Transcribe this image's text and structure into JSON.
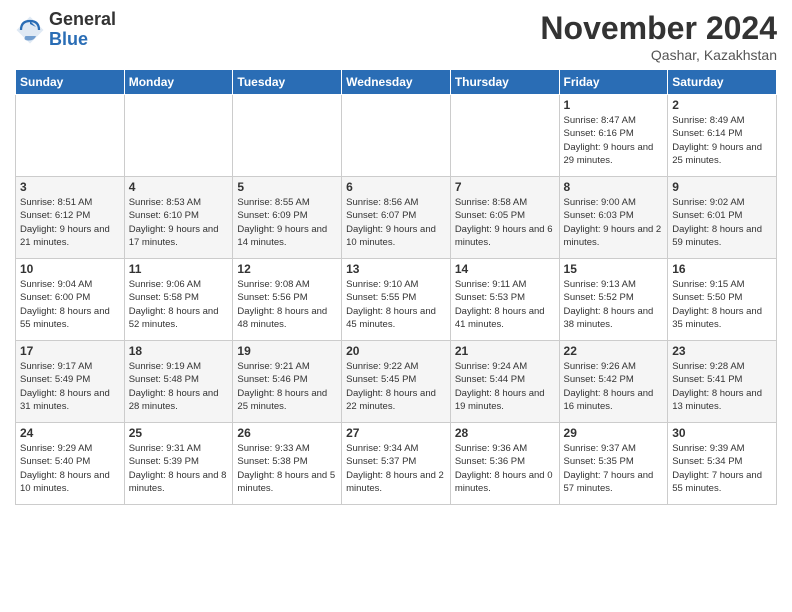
{
  "header": {
    "logo_general": "General",
    "logo_blue": "Blue",
    "month_title": "November 2024",
    "location": "Qashar, Kazakhstan"
  },
  "weekdays": [
    "Sunday",
    "Monday",
    "Tuesday",
    "Wednesday",
    "Thursday",
    "Friday",
    "Saturday"
  ],
  "weeks": [
    [
      {
        "day": "",
        "info": ""
      },
      {
        "day": "",
        "info": ""
      },
      {
        "day": "",
        "info": ""
      },
      {
        "day": "",
        "info": ""
      },
      {
        "day": "",
        "info": ""
      },
      {
        "day": "1",
        "info": "Sunrise: 8:47 AM\nSunset: 6:16 PM\nDaylight: 9 hours and 29 minutes."
      },
      {
        "day": "2",
        "info": "Sunrise: 8:49 AM\nSunset: 6:14 PM\nDaylight: 9 hours and 25 minutes."
      }
    ],
    [
      {
        "day": "3",
        "info": "Sunrise: 8:51 AM\nSunset: 6:12 PM\nDaylight: 9 hours and 21 minutes."
      },
      {
        "day": "4",
        "info": "Sunrise: 8:53 AM\nSunset: 6:10 PM\nDaylight: 9 hours and 17 minutes."
      },
      {
        "day": "5",
        "info": "Sunrise: 8:55 AM\nSunset: 6:09 PM\nDaylight: 9 hours and 14 minutes."
      },
      {
        "day": "6",
        "info": "Sunrise: 8:56 AM\nSunset: 6:07 PM\nDaylight: 9 hours and 10 minutes."
      },
      {
        "day": "7",
        "info": "Sunrise: 8:58 AM\nSunset: 6:05 PM\nDaylight: 9 hours and 6 minutes."
      },
      {
        "day": "8",
        "info": "Sunrise: 9:00 AM\nSunset: 6:03 PM\nDaylight: 9 hours and 2 minutes."
      },
      {
        "day": "9",
        "info": "Sunrise: 9:02 AM\nSunset: 6:01 PM\nDaylight: 8 hours and 59 minutes."
      }
    ],
    [
      {
        "day": "10",
        "info": "Sunrise: 9:04 AM\nSunset: 6:00 PM\nDaylight: 8 hours and 55 minutes."
      },
      {
        "day": "11",
        "info": "Sunrise: 9:06 AM\nSunset: 5:58 PM\nDaylight: 8 hours and 52 minutes."
      },
      {
        "day": "12",
        "info": "Sunrise: 9:08 AM\nSunset: 5:56 PM\nDaylight: 8 hours and 48 minutes."
      },
      {
        "day": "13",
        "info": "Sunrise: 9:10 AM\nSunset: 5:55 PM\nDaylight: 8 hours and 45 minutes."
      },
      {
        "day": "14",
        "info": "Sunrise: 9:11 AM\nSunset: 5:53 PM\nDaylight: 8 hours and 41 minutes."
      },
      {
        "day": "15",
        "info": "Sunrise: 9:13 AM\nSunset: 5:52 PM\nDaylight: 8 hours and 38 minutes."
      },
      {
        "day": "16",
        "info": "Sunrise: 9:15 AM\nSunset: 5:50 PM\nDaylight: 8 hours and 35 minutes."
      }
    ],
    [
      {
        "day": "17",
        "info": "Sunrise: 9:17 AM\nSunset: 5:49 PM\nDaylight: 8 hours and 31 minutes."
      },
      {
        "day": "18",
        "info": "Sunrise: 9:19 AM\nSunset: 5:48 PM\nDaylight: 8 hours and 28 minutes."
      },
      {
        "day": "19",
        "info": "Sunrise: 9:21 AM\nSunset: 5:46 PM\nDaylight: 8 hours and 25 minutes."
      },
      {
        "day": "20",
        "info": "Sunrise: 9:22 AM\nSunset: 5:45 PM\nDaylight: 8 hours and 22 minutes."
      },
      {
        "day": "21",
        "info": "Sunrise: 9:24 AM\nSunset: 5:44 PM\nDaylight: 8 hours and 19 minutes."
      },
      {
        "day": "22",
        "info": "Sunrise: 9:26 AM\nSunset: 5:42 PM\nDaylight: 8 hours and 16 minutes."
      },
      {
        "day": "23",
        "info": "Sunrise: 9:28 AM\nSunset: 5:41 PM\nDaylight: 8 hours and 13 minutes."
      }
    ],
    [
      {
        "day": "24",
        "info": "Sunrise: 9:29 AM\nSunset: 5:40 PM\nDaylight: 8 hours and 10 minutes."
      },
      {
        "day": "25",
        "info": "Sunrise: 9:31 AM\nSunset: 5:39 PM\nDaylight: 8 hours and 8 minutes."
      },
      {
        "day": "26",
        "info": "Sunrise: 9:33 AM\nSunset: 5:38 PM\nDaylight: 8 hours and 5 minutes."
      },
      {
        "day": "27",
        "info": "Sunrise: 9:34 AM\nSunset: 5:37 PM\nDaylight: 8 hours and 2 minutes."
      },
      {
        "day": "28",
        "info": "Sunrise: 9:36 AM\nSunset: 5:36 PM\nDaylight: 8 hours and 0 minutes."
      },
      {
        "day": "29",
        "info": "Sunrise: 9:37 AM\nSunset: 5:35 PM\nDaylight: 7 hours and 57 minutes."
      },
      {
        "day": "30",
        "info": "Sunrise: 9:39 AM\nSunset: 5:34 PM\nDaylight: 7 hours and 55 minutes."
      }
    ]
  ]
}
